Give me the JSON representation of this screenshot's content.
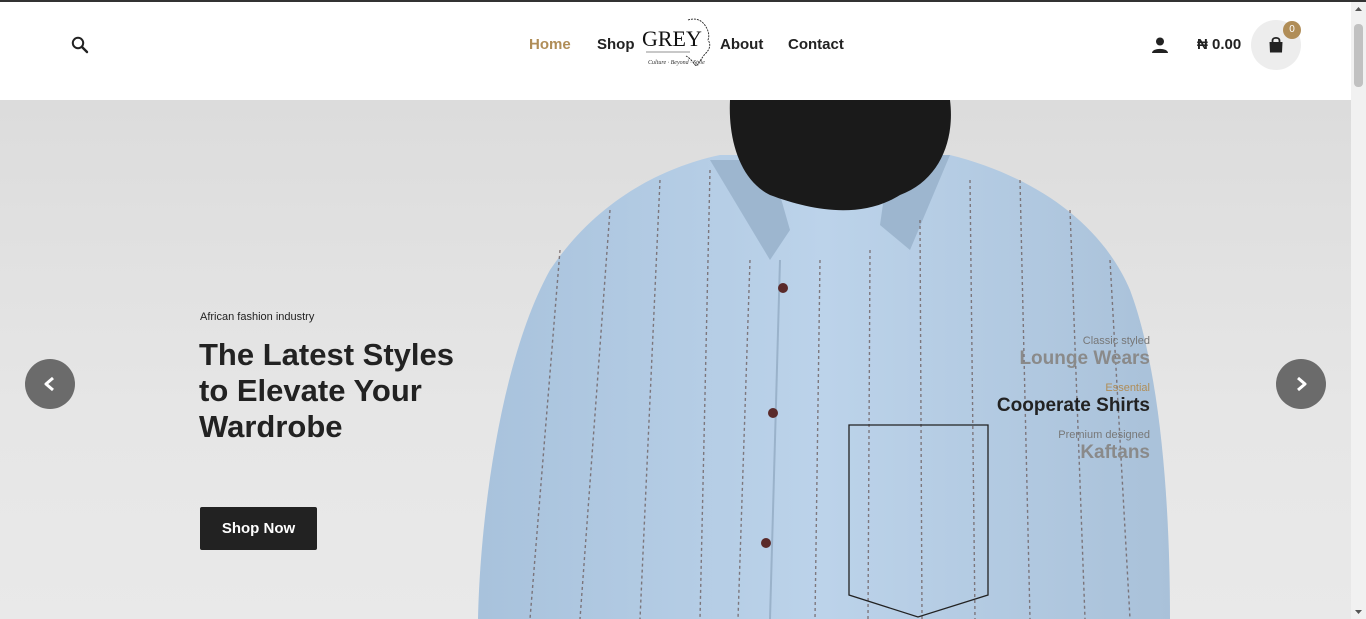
{
  "header": {
    "nav": [
      {
        "label": "Home",
        "active": true
      },
      {
        "label": "Shop",
        "active": false
      },
      {
        "label": "About",
        "active": false
      },
      {
        "label": "Contact",
        "active": false
      }
    ],
    "logo": {
      "text": "GREY",
      "tagline": "Culture · Beyond · Style"
    },
    "icons": {
      "search": "search-icon",
      "user": "user-icon",
      "cart": "shopping-bag-icon"
    },
    "cart_total": "₦ 0.00",
    "cart_count": "0"
  },
  "hero": {
    "kicker": "African fashion industry",
    "headline": "The Latest Styles to Elevate Your Wardrobe",
    "cta_label": "Shop Now",
    "slides": [
      {
        "subtitle": "Classic styled",
        "title": "Lounge Wears",
        "active": false
      },
      {
        "subtitle": "Essential",
        "title": "Cooperate Shirts",
        "active": true
      },
      {
        "subtitle": "Premium designed",
        "title": "Kaftans",
        "active": false
      }
    ]
  },
  "colors": {
    "accent": "#b08d57",
    "text": "#222222",
    "arrow_bg": "#6b6b6b",
    "shirt": "#b7cfe6"
  }
}
